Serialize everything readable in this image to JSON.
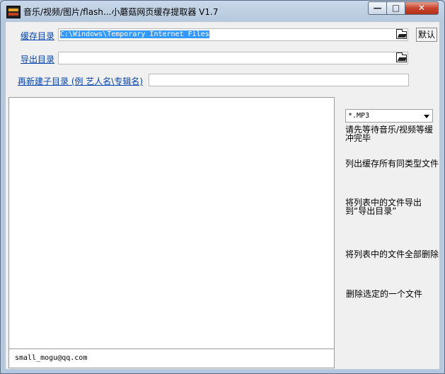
{
  "window": {
    "title": "音乐/视频/图片/flash...小蘑菇网页缓存提取器 V1.7",
    "min_glyph": "—",
    "max_glyph": "□",
    "close_glyph": "✕"
  },
  "cache_dir": {
    "label": "缓存目录",
    "value": "C:\\Windows\\Temporary Internet Files",
    "browse_icon": "folder-open-icon"
  },
  "default_button": {
    "label": "默认"
  },
  "export_dir": {
    "label": "导出目录",
    "value": "",
    "browse_icon": "folder-open-icon"
  },
  "rebuild_subdir": {
    "label": "再新建子目录 (例 艺人名\\专辑名)",
    "value": ""
  },
  "file_list": {
    "items": []
  },
  "status_bar": {
    "text": "small_mogu@qq.com"
  },
  "actions": {
    "file_type": "*.MP3",
    "wait_text": "请先等待音乐/视频等缓冲完毕",
    "list_all": "列出缓存所有同类型文件",
    "export_all": "将列表中的文件导出到“导出目录”",
    "delete_all": "将列表中的文件全部删除",
    "delete_selected": "删除选定的一个文件"
  }
}
